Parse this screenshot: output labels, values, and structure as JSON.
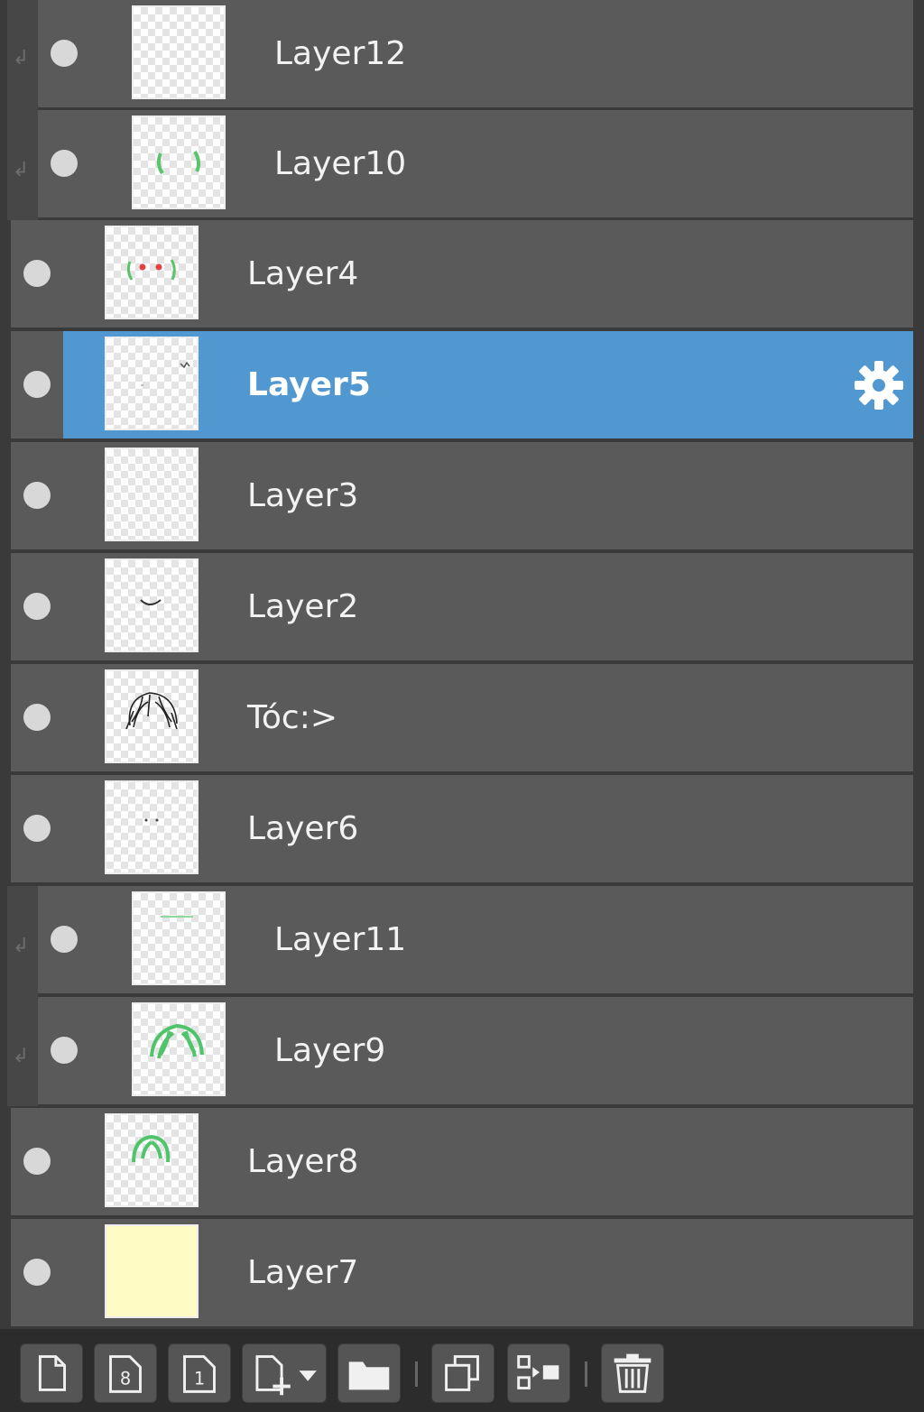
{
  "layers": [
    {
      "id": "layer12",
      "name": "Layer12",
      "clipped": true,
      "thumb": "blank"
    },
    {
      "id": "layer10",
      "name": "Layer10",
      "clipped": true,
      "thumb": "green-brackets"
    },
    {
      "id": "layer4",
      "name": "Layer4",
      "clipped": false,
      "thumb": "red-dots"
    },
    {
      "id": "layer5",
      "name": "Layer5",
      "clipped": false,
      "selected": true,
      "thumb": "sketch-small"
    },
    {
      "id": "layer3",
      "name": "Layer3",
      "clipped": false,
      "thumb": "blank"
    },
    {
      "id": "layer2",
      "name": "Layer2",
      "clipped": false,
      "thumb": "mouth"
    },
    {
      "id": "toc",
      "name": "Tóc:>",
      "clipped": false,
      "thumb": "hair-sketch"
    },
    {
      "id": "layer6",
      "name": "Layer6",
      "clipped": false,
      "thumb": "dots"
    },
    {
      "id": "layer11",
      "name": "Layer11",
      "clipped": true,
      "thumb": "green-line"
    },
    {
      "id": "layer9",
      "name": "Layer9",
      "clipped": true,
      "thumb": "green-hair"
    },
    {
      "id": "layer8",
      "name": "Layer8",
      "clipped": false,
      "thumb": "green-arc"
    },
    {
      "id": "layer7",
      "name": "Layer7",
      "clipped": false,
      "thumb": "yellow-fill"
    }
  ],
  "colors": {
    "selected": "#5098cf",
    "row": "#5a5a5a",
    "background": "#3a3a3a"
  },
  "toolbar": {
    "buttons": [
      {
        "name": "new-layer-button",
        "icon": "page-icon"
      },
      {
        "name": "new-8bit-layer-button",
        "icon": "page-8-icon"
      },
      {
        "name": "new-1bit-layer-button",
        "icon": "page-1-icon"
      },
      {
        "name": "add-layer-menu-button",
        "icon": "page-plus-dropdown-icon"
      },
      {
        "name": "new-folder-button",
        "icon": "folder-icon"
      },
      {
        "name": "duplicate-layer-button",
        "icon": "duplicate-icon"
      },
      {
        "name": "merge-layer-button",
        "icon": "merge-icon"
      },
      {
        "name": "delete-layer-button",
        "icon": "trash-icon"
      }
    ]
  }
}
